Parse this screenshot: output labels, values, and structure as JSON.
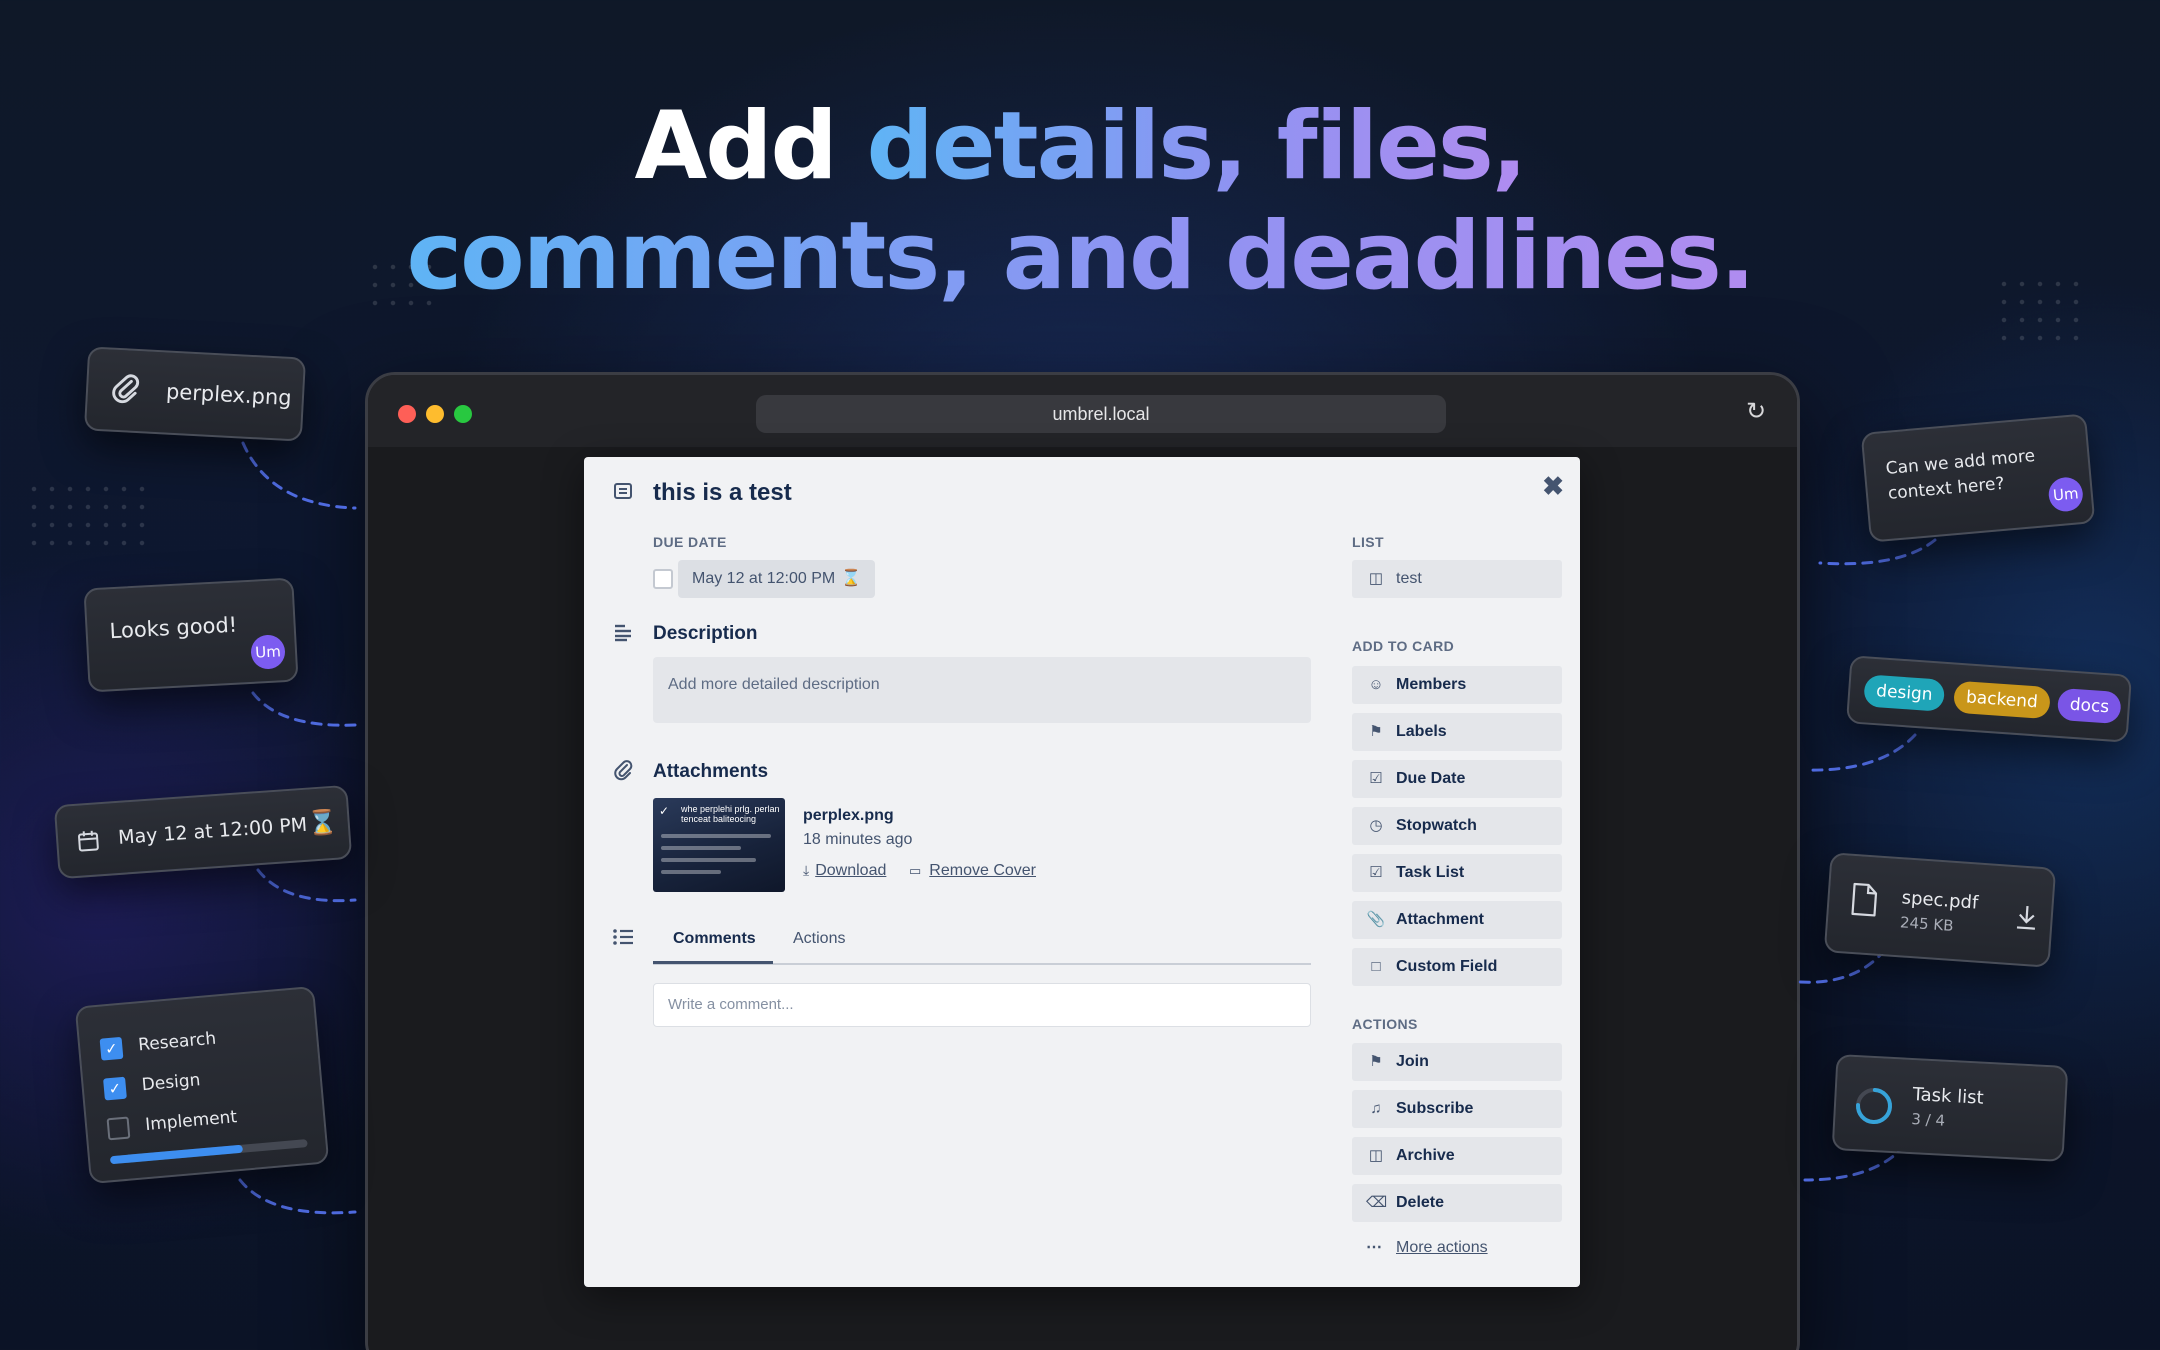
{
  "headline": {
    "line1_white": "Add",
    "line1_grad": "details, files,",
    "line2_grad": "comments, and deadlines."
  },
  "browser": {
    "url": "umbrel.local"
  },
  "card": {
    "title": "this is a test",
    "due_date_label": "DUE DATE",
    "due_date_value": "May 12 at 12:00 PM",
    "description_heading": "Description",
    "description_placeholder": "Add more detailed description",
    "attachments_heading": "Attachments",
    "attachment": {
      "thumbnail_text": "whe perplehi prlg. perlan tenceat baliteocing",
      "name": "perplex.png",
      "time": "18 minutes ago",
      "download_label": "Download",
      "remove_cover_label": "Remove Cover"
    },
    "tabs": [
      "Comments",
      "Actions"
    ],
    "comment_placeholder": "Write a comment..."
  },
  "sidebar": {
    "list_label": "LIST",
    "list_value": "test",
    "add_to_card_label": "ADD TO CARD",
    "add_to_card": [
      "Members",
      "Labels",
      "Due Date",
      "Stopwatch",
      "Task List",
      "Attachment",
      "Custom Field"
    ],
    "actions_label": "ACTIONS",
    "actions": [
      "Join",
      "Subscribe",
      "Archive",
      "Delete"
    ],
    "more_actions": "More actions"
  },
  "floating": {
    "file_name": "perplex.png",
    "comment1": "Looks good!",
    "avatar_initials": "Um",
    "due": "May 12 at 12:00 PM",
    "checklist": [
      {
        "label": "Research",
        "checked": true
      },
      {
        "label": "Design",
        "checked": true
      },
      {
        "label": "Implement",
        "checked": false
      }
    ],
    "checklist_progress": 0.67,
    "comment2": "Can we add more context here?",
    "tags": [
      {
        "label": "design",
        "color": "#1fa5b8"
      },
      {
        "label": "backend",
        "color": "#c9961a"
      },
      {
        "label": "docs",
        "color": "#7a55e6"
      }
    ],
    "spec_file": "spec.pdf",
    "spec_size": "245 KB",
    "task_list_label": "Task list",
    "task_list_count": "3 / 4",
    "task_list_progress": 0.75
  },
  "colors": {
    "accent_blue": "#5fb4f5",
    "accent_purple": "#b08cf0",
    "hourglass": "#e56910",
    "dash_line": "#4f6be0"
  }
}
